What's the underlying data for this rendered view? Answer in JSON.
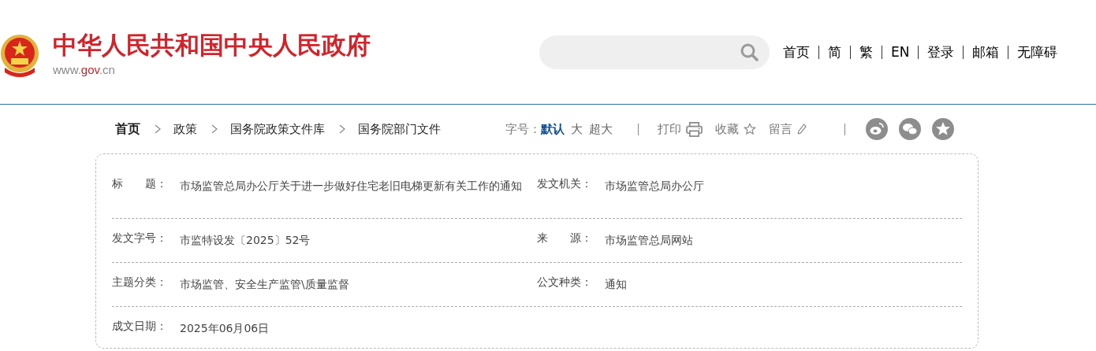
{
  "header": {
    "site_title": "中华人民共和国中央人民政府",
    "site_url": {
      "prefix": "www.",
      "highlight": "gov",
      "suffix": ".cn"
    }
  },
  "top_links": [
    "首页",
    "简",
    "繁",
    "EN",
    "登录",
    "邮箱",
    "无障碍"
  ],
  "breadcrumb": [
    "首页",
    "政策",
    "国务院政策文件库",
    "国务院部门文件"
  ],
  "font_size": {
    "label": "字号：",
    "options": [
      {
        "label": "默认",
        "selected": true
      },
      {
        "label": "大",
        "selected": false
      },
      {
        "label": "超大",
        "selected": false
      }
    ]
  },
  "tools": [
    {
      "label": "打印",
      "kind": "print"
    },
    {
      "label": "收藏",
      "kind": "favorite"
    },
    {
      "label": "留言",
      "kind": "comment"
    }
  ],
  "share": [
    {
      "kind": "weibo"
    },
    {
      "kind": "wechat"
    },
    {
      "kind": "qzone"
    }
  ],
  "info_rows": [
    {
      "left": {
        "label": "标　　题：",
        "value": "市场监管总局办公厅关于进一步做好住宅老旧电梯更新有关工作的通知"
      },
      "right": {
        "label": "发文机关：",
        "value": "市场监管总局办公厅"
      }
    },
    {
      "left": {
        "label": "发文字号：",
        "value": "市监特设发〔2025〕52号"
      },
      "right": {
        "label": "来　　源：",
        "value": "市场监管总局网站"
      }
    },
    {
      "left": {
        "label": "主题分类：",
        "value": "市场监管、安全生产监管\\质量监督"
      },
      "right": {
        "label": "公文种类：",
        "value": "通知"
      }
    },
    {
      "left": {
        "label": "成文日期：",
        "value": "2025年06月06日"
      }
    }
  ]
}
